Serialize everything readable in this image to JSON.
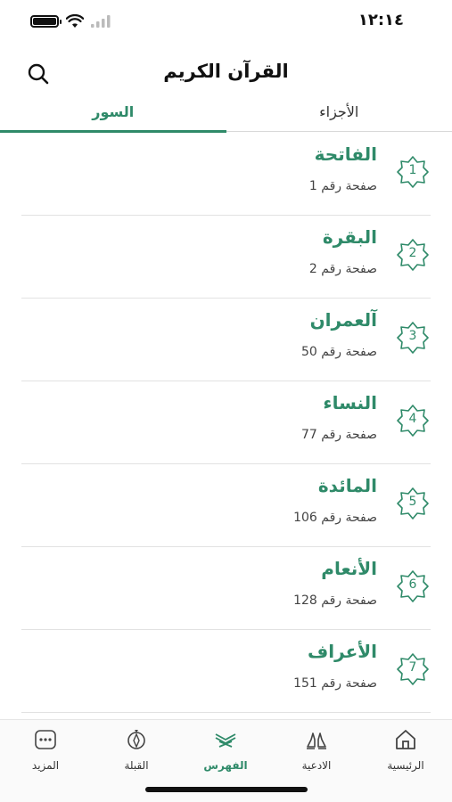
{
  "status": {
    "time": "١٢:١٤"
  },
  "header": {
    "title": "القرآن الكريم"
  },
  "tabs": {
    "suras": "السور",
    "juz": "الأجزاء"
  },
  "suras": [
    {
      "num": "1",
      "name": "الفاتحة",
      "page_label": "صفحة رقم",
      "page": "1"
    },
    {
      "num": "2",
      "name": "البقرة",
      "page_label": "صفحة رقم",
      "page": "2"
    },
    {
      "num": "3",
      "name": "آلعمران",
      "page_label": "صفحة رقم",
      "page": "50"
    },
    {
      "num": "4",
      "name": "النساء",
      "page_label": "صفحة رقم",
      "page": "77"
    },
    {
      "num": "5",
      "name": "المائدة",
      "page_label": "صفحة رقم",
      "page": "106"
    },
    {
      "num": "6",
      "name": "الأنعام",
      "page_label": "صفحة رقم",
      "page": "128"
    },
    {
      "num": "7",
      "name": "الأعراف",
      "page_label": "صفحة رقم",
      "page": "151"
    }
  ],
  "tabbar": {
    "home": "الرئيسية",
    "duas": "الادعية",
    "index": "الفهرس",
    "qibla": "القبلة",
    "more": "المزيد"
  },
  "colors": {
    "accent": "#2f8a69"
  }
}
